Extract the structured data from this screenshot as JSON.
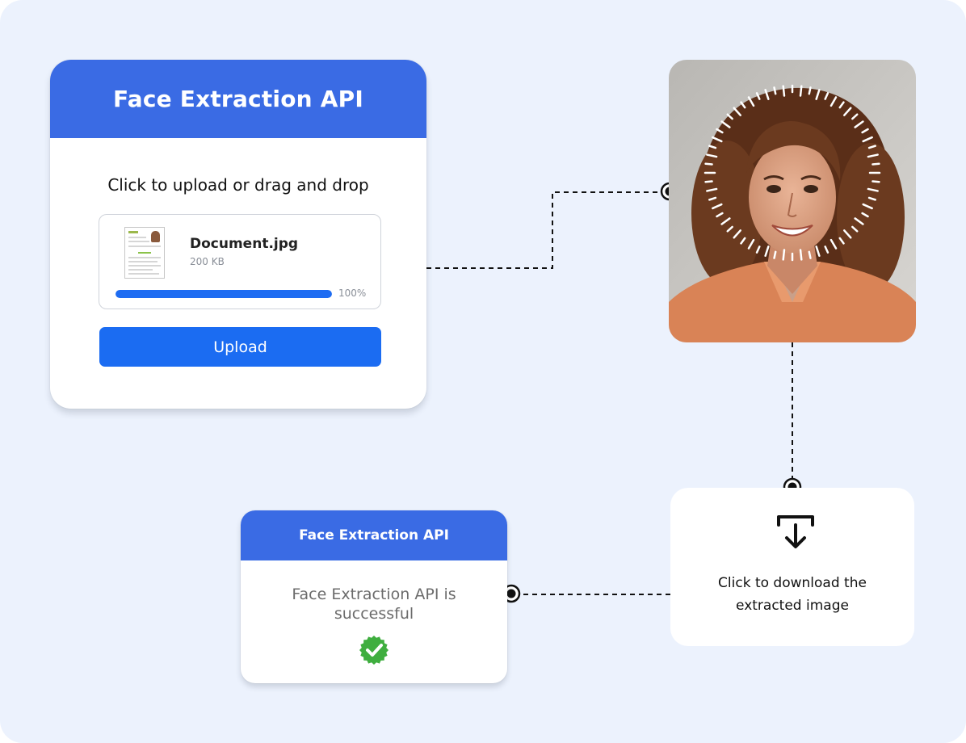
{
  "upload_card": {
    "title": "Face Extraction API",
    "prompt": "Click to upload or drag and drop",
    "file": {
      "name": "Document.jpg",
      "size": "200 KB",
      "progress_label": "100%",
      "progress_fraction": 1.0
    },
    "upload_button_label": "Upload"
  },
  "photo": {
    "description_icon": "face-detection-ring-icon"
  },
  "download_card": {
    "icon": "download-icon",
    "text_line1": "Click to download the",
    "text_line2": "extracted image"
  },
  "success_card": {
    "title": "Face Extraction API",
    "message": "Face Extraction API is successful",
    "icon": "check-badge-icon"
  },
  "colors": {
    "background": "#ecf2fd",
    "header_blue": "#3a6be4",
    "button_blue": "#1b6cf2",
    "success_green": "#3fae3f"
  }
}
